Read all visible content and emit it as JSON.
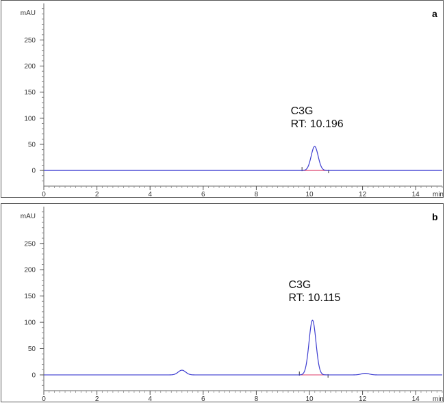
{
  "chart_data": [
    {
      "type": "line",
      "panel_label": "a",
      "ylabel": "mAU",
      "xlabel": "min",
      "xlim": [
        0,
        15
      ],
      "ylim": [
        -30,
        320
      ],
      "x_ticks": [
        0,
        2,
        4,
        6,
        8,
        10,
        12,
        14
      ],
      "y_ticks": [
        0,
        50,
        100,
        150,
        200,
        250
      ],
      "annotation": {
        "line1": "C3G",
        "line2": "RT: 10.196",
        "x": 10.196,
        "y": 46
      },
      "peaks": [
        {
          "rt": 10.196,
          "height": 46,
          "width": 0.13
        }
      ],
      "integration_baseline": [
        9.72,
        10.72
      ],
      "colors": {
        "trace": "#3b3bd0",
        "baseline": "#e0507a"
      }
    },
    {
      "type": "line",
      "panel_label": "b",
      "ylabel": "mAU",
      "xlabel": "min",
      "xlim": [
        0,
        15
      ],
      "ylim": [
        -30,
        320
      ],
      "x_ticks": [
        0,
        2,
        4,
        6,
        8,
        10,
        12,
        14
      ],
      "y_ticks": [
        0,
        50,
        100,
        150,
        200,
        250
      ],
      "annotation": {
        "line1": "C3G",
        "line2": "RT: 10.115",
        "x": 10.115,
        "y": 104
      },
      "peaks": [
        {
          "rt": 5.2,
          "height": 9,
          "width": 0.14
        },
        {
          "rt": 10.115,
          "height": 104,
          "width": 0.13
        },
        {
          "rt": 12.1,
          "height": 3,
          "width": 0.15
        }
      ],
      "integration_baseline": [
        9.62,
        10.7
      ],
      "colors": {
        "trace": "#3b3bd0",
        "baseline": "#e0507a"
      }
    }
  ]
}
